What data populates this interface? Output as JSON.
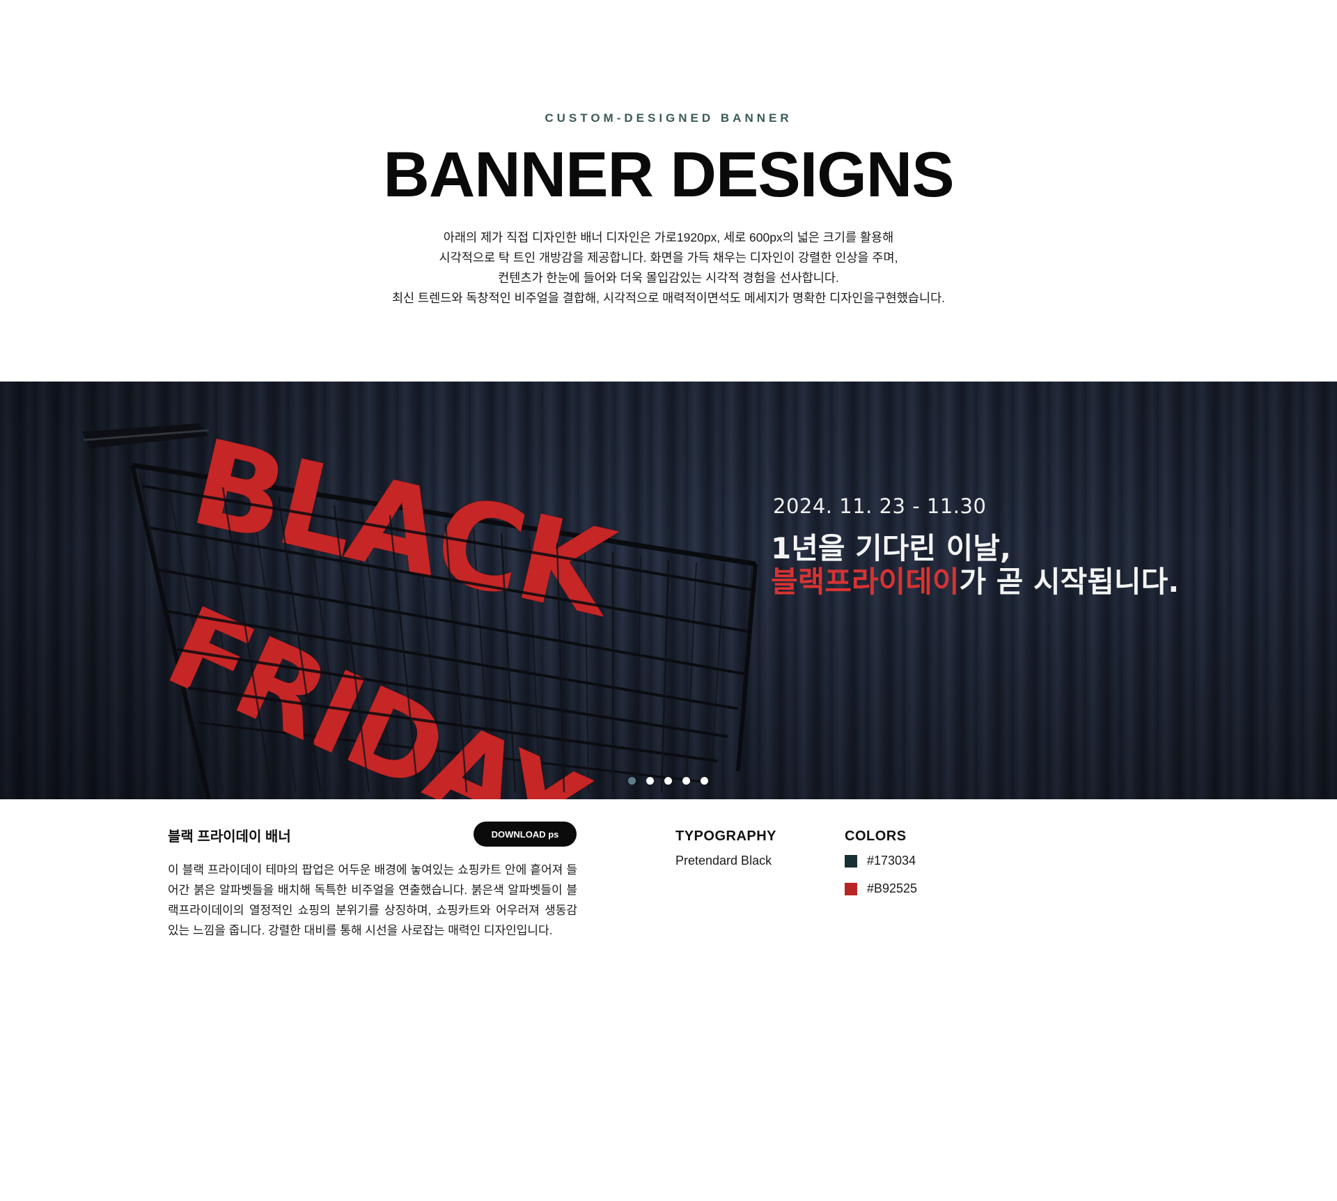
{
  "header": {
    "eyebrow": "CUSTOM-DESIGNED BANNER",
    "title": "BANNER DESIGNS",
    "intro_lines": [
      "아래의 제가 직접 디자인한 배너 디자인은 가로1920px, 세로 600px의 넓은 크기를 활용해",
      "시각적으로 탁 트인 개방감을 제공합니다. 화면을 가득 채우는 디자인이 강렬한 인상을 주며,",
      "컨텐츠가 한눈에 들어와 더욱 몰입감있는 시각적 경험을 선사합니다.",
      "최신 트렌드와 독창적인 비주얼을 결합해, 시각적으로 매력적이면석도 메세지가 명확한 디자인을구현했습니다."
    ]
  },
  "banner": {
    "artwork_word_1": "BLACK",
    "artwork_word_2": "FRIDAY",
    "date": "2024. 11. 23 - 11.30",
    "headline_1": "1년을 기다린 이날,",
    "headline_2_highlight": "블랙프라이데이",
    "headline_2_rest": "가 곧 시작됩니다.",
    "highlight_color": "#d63333",
    "slide_count": 5,
    "active_slide": 1
  },
  "project": {
    "title": "블랙 프라이데이  배너",
    "download_label": "DOWNLOAD ps",
    "description": "이 블랙 프라이데이 테마의 팝업은 어두운 배경에 놓여있는 쇼핑카트 안에 흩어져 들어간 붉은 알파벳들을 배치해 독특한 비주얼을 연출했습니다. 붉은색 알파벳들이 블랙프라이데이의 열정적인 쇼핑의 분위기를 상징하며, 쇼핑카트와 어우러져 생동감 있는 느낌을 줍니다. 강렬한 대비를 통해 시선을 사로잡는 매력인 디자인입니다."
  },
  "typography": {
    "heading": "TYPOGRAPHY",
    "font": "Pretendard Black"
  },
  "colors": {
    "heading": "COLORS",
    "swatches": [
      {
        "hex": "#173034",
        "label": "#173034"
      },
      {
        "hex": "#B92525",
        "label": "#B92525"
      }
    ]
  }
}
